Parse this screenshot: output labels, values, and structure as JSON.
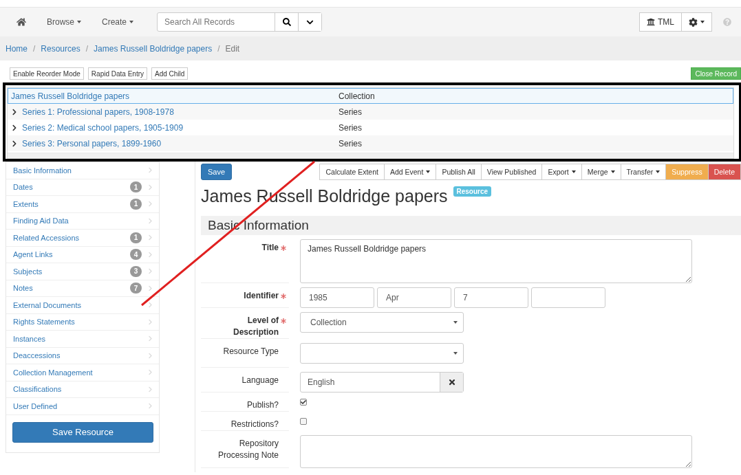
{
  "navbar": {
    "menus": [
      {
        "label": "Browse"
      },
      {
        "label": "Create"
      }
    ],
    "search": {
      "placeholder": "Search All Records"
    },
    "repo_button": "TML"
  },
  "breadcrumb": {
    "separator": "/",
    "items": [
      "Home",
      "Resources",
      "James Russell Boldridge papers",
      "Edit"
    ]
  },
  "toolbar": {
    "buttons": [
      "Enable Reorder Mode",
      "Rapid Data Entry",
      "Add Child"
    ],
    "close": "Close Record"
  },
  "tree": {
    "rows": [
      {
        "title": "James Russell Boldridge papers",
        "level": "Collection",
        "expandable": false,
        "selected": true
      },
      {
        "title": "Series 1: Professional papers, 1908-1978",
        "level": "Series",
        "expandable": true,
        "selected": false
      },
      {
        "title": "Series 2: Medical school papers, 1905-1909",
        "level": "Series",
        "expandable": true,
        "selected": false
      },
      {
        "title": "Series 3: Personal papers, 1899-1960",
        "level": "Series",
        "expandable": true,
        "selected": false
      }
    ]
  },
  "sidebar": {
    "items": [
      {
        "label": "Basic Information"
      },
      {
        "label": "Dates",
        "count": "1"
      },
      {
        "label": "Extents",
        "count": "1"
      },
      {
        "label": "Finding Aid Data"
      },
      {
        "label": "Related Accessions",
        "count": "1"
      },
      {
        "label": "Agent Links",
        "count": "4"
      },
      {
        "label": "Subjects",
        "count": "3"
      },
      {
        "label": "Notes",
        "count": "7"
      },
      {
        "label": "External Documents"
      },
      {
        "label": "Rights Statements"
      },
      {
        "label": "Instances"
      },
      {
        "label": "Deaccessions"
      },
      {
        "label": "Collection Management"
      },
      {
        "label": "Classifications"
      },
      {
        "label": "User Defined"
      }
    ],
    "save": "Save Resource"
  },
  "record_toolbar": {
    "save": "Save",
    "buttons": [
      {
        "label": "Calculate Extent",
        "kind": "plain"
      },
      {
        "label": "Add Event",
        "kind": "dropdown"
      },
      {
        "label": "Publish All",
        "kind": "plain"
      },
      {
        "label": "View Published",
        "kind": "plain"
      },
      {
        "label": "Export",
        "kind": "dropdown"
      },
      {
        "label": "Merge",
        "kind": "dropdown"
      },
      {
        "label": "Transfer",
        "kind": "dropdown"
      },
      {
        "label": "Suppress",
        "kind": "warning"
      },
      {
        "label": "Delete",
        "kind": "danger"
      }
    ]
  },
  "record": {
    "title": "James Russell Boldridge papers",
    "badge": "Resource"
  },
  "section": {
    "title": "Basic Information"
  },
  "fields": [
    {
      "kind": "textarea",
      "label": "Title",
      "required": true,
      "value": "James Russell Boldridge papers"
    },
    {
      "kind": "identifier",
      "label": "Identifier",
      "required": true,
      "parts": [
        "1985",
        "Apr",
        "7"
      ]
    },
    {
      "kind": "select",
      "label": "Level of Description",
      "required": true,
      "value": "Collection"
    },
    {
      "kind": "select",
      "label": "Resource Type",
      "required": false
    },
    {
      "kind": "combo",
      "label": "Language",
      "required": false,
      "value": "English"
    },
    {
      "kind": "checkbox",
      "label": "Publish?",
      "required": false,
      "checked": true
    },
    {
      "kind": "checkbox",
      "label": "Restrictions?",
      "required": false,
      "checked": false
    },
    {
      "kind": "textarea",
      "label": "Repository Processing Note",
      "required": false
    }
  ]
}
